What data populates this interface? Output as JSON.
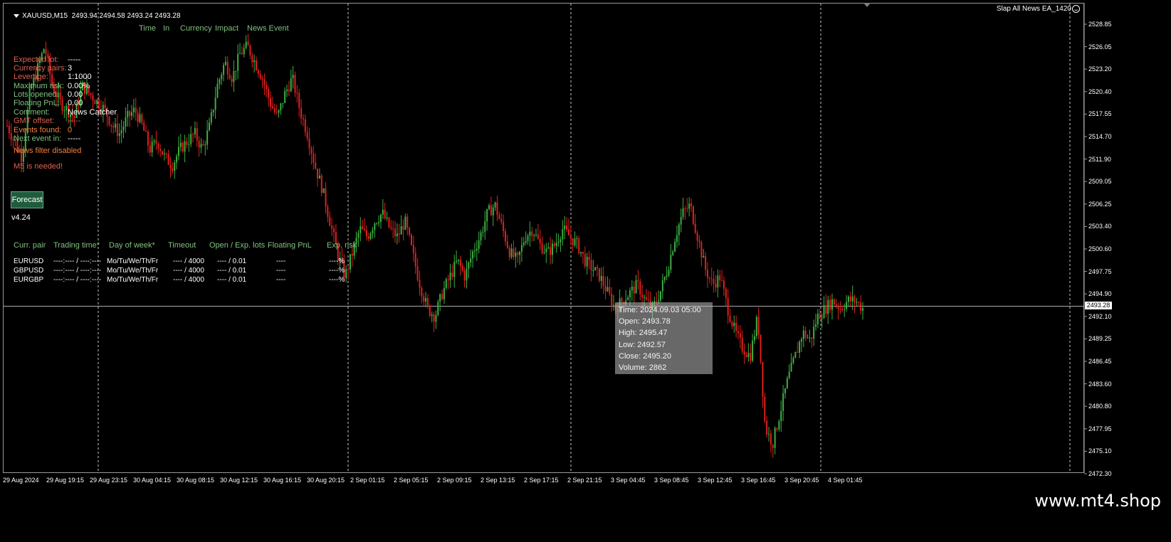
{
  "header": {
    "symbol": "XAUUSD,M15",
    "ohlc": "2493.94 2494.58 2493.24 2493.28",
    "ea_name": "Slap All News EA_1420"
  },
  "news_columns": [
    "Time",
    "In",
    "Currency",
    "Impact",
    "News Event"
  ],
  "info": [
    {
      "label": "Expected lot:",
      "value": "-----",
      "color": "red"
    },
    {
      "label": "Currency pairs:",
      "value": "3",
      "color": "red"
    },
    {
      "label": "Leverage:",
      "value": "1:1000",
      "color": "red"
    },
    {
      "label": "Maximum risk:",
      "value": "0.00%",
      "color": "green"
    },
    {
      "label": "Lots opened:",
      "value": "0.00",
      "color": "green"
    },
    {
      "label": "Floating PnL:",
      "value": "0.00",
      "color": "green"
    },
    {
      "label": "Comment:",
      "value": "News Catcher",
      "color": "green"
    },
    {
      "label": "GMT offset:",
      "value": "-----",
      "color": "red"
    },
    {
      "label": "Events found:",
      "value": "0",
      "color": "orange"
    },
    {
      "label": "Next event in:",
      "value": "-----",
      "color": "green"
    }
  ],
  "news_filter_status": "News filter disabled",
  "m5_warning": "M5 is needed!",
  "forecast_button": "Forecast",
  "version": "v4.24",
  "pairs_table": {
    "headers": [
      "Curr. pair",
      "Trading time*",
      "Day of week*",
      "Timeout",
      "Open / Exp. lots",
      "Floating PnL",
      "Exp. risk"
    ],
    "rows": [
      {
        "pair": "EURUSD",
        "time": "----:---- / ----:----",
        "days": "Mo/Tu/We/Th/Fr",
        "timeout": "---- / 4000",
        "lots": "---- / 0.01",
        "pnl": "----",
        "risk": "----%"
      },
      {
        "pair": "GBPUSD",
        "time": "----:---- / ----:----",
        "days": "Mo/Tu/We/Th/Fr",
        "timeout": "---- / 4000",
        "lots": "---- / 0.01",
        "pnl": "----",
        "risk": "----%"
      },
      {
        "pair": "EURGBP",
        "time": "----:---- / ----:----",
        "days": "Mo/Tu/We/Th/Fr",
        "timeout": "---- / 4000",
        "lots": "---- / 0.01",
        "pnl": "----",
        "risk": "----%"
      }
    ]
  },
  "tooltip": {
    "time": "Time: 2024.09.03 05:00",
    "open": "Open: 2493.78",
    "high": "High: 2495.47",
    "low": "Low:  2492.57",
    "close": "Close: 2495.20",
    "volume": "Volume: 2862"
  },
  "price_axis": [
    "2528.85",
    "2526.05",
    "2523.20",
    "2520.40",
    "2517.55",
    "2514.70",
    "2511.90",
    "2509.05",
    "2506.25",
    "2503.40",
    "2500.60",
    "2497.75",
    "2494.90",
    "2492.10",
    "2489.25",
    "2486.45",
    "2483.60",
    "2480.80",
    "2477.95",
    "2475.10",
    "2472.30"
  ],
  "current_price": "2493.28",
  "time_axis": [
    "29 Aug 2024",
    "29 Aug 19:15",
    "29 Aug 23:15",
    "30 Aug 04:15",
    "30 Aug 08:15",
    "30 Aug 12:15",
    "30 Aug 16:15",
    "30 Aug 20:15",
    "2 Sep 01:15",
    "2 Sep 05:15",
    "2 Sep 09:15",
    "2 Sep 13:15",
    "2 Sep 17:15",
    "2 Sep 21:15",
    "3 Sep 04:45",
    "3 Sep 08:45",
    "3 Sep 12:45",
    "3 Sep 16:45",
    "3 Sep 20:45",
    "4 Sep 01:45"
  ],
  "watermark": "www.mt4.shop",
  "colors": {
    "bull": "#3cb043",
    "bear": "#e0201e",
    "label_red": "#e06050",
    "label_green": "#7fc37f",
    "label_orange": "#f08040"
  },
  "price_series": [
    2516,
    2514,
    2512,
    2520,
    2523,
    2526,
    2521,
    2519,
    2518,
    2517,
    2521,
    2520,
    2519,
    2518,
    2516,
    2515,
    2517,
    2518,
    2516,
    2513,
    2514,
    2512,
    2511,
    2513,
    2514,
    2515,
    2513,
    2516,
    2521,
    2524,
    2522,
    2525,
    2526,
    2524,
    2522,
    2519,
    2517,
    2520,
    2522,
    2518,
    2515,
    2511,
    2508,
    2504,
    2500,
    2497,
    2500,
    2503,
    2502,
    2504,
    2505,
    2503,
    2502,
    2504,
    2500,
    2496,
    2493,
    2492,
    2495,
    2497,
    2499,
    2497,
    2500,
    2502,
    2505,
    2506,
    2503,
    2500,
    2499,
    2502,
    2503,
    2501,
    2500,
    2501,
    2503,
    2502,
    2501,
    2499,
    2498,
    2497,
    2495,
    2493,
    2494,
    2495,
    2496,
    2494,
    2493,
    2495,
    2498,
    2502,
    2505,
    2506,
    2502,
    2498,
    2496,
    2497,
    2493,
    2490,
    2488,
    2487,
    2492,
    2478,
    2476,
    2480,
    2484,
    2487,
    2490,
    2489,
    2492,
    2493,
    2494,
    2493,
    2494,
    2494,
    2493
  ]
}
